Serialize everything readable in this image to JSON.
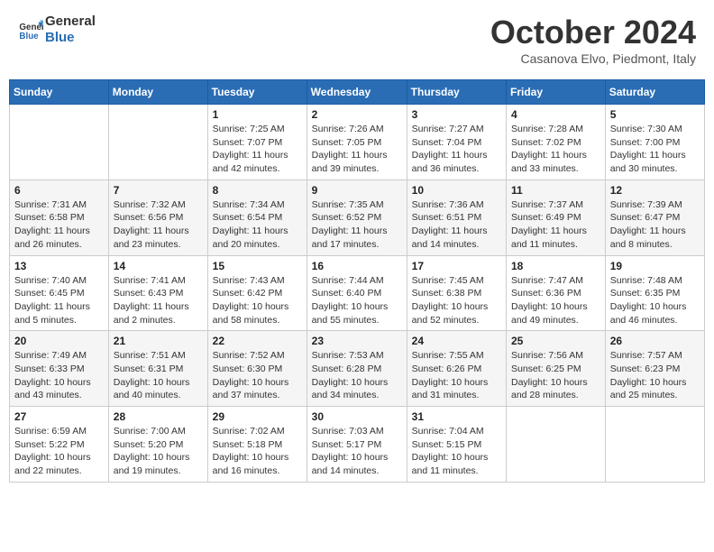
{
  "header": {
    "logo_line1": "General",
    "logo_line2": "Blue",
    "month": "October 2024",
    "location": "Casanova Elvo, Piedmont, Italy"
  },
  "weekdays": [
    "Sunday",
    "Monday",
    "Tuesday",
    "Wednesday",
    "Thursday",
    "Friday",
    "Saturday"
  ],
  "weeks": [
    [
      {
        "day": "",
        "info": ""
      },
      {
        "day": "",
        "info": ""
      },
      {
        "day": "1",
        "info": "Sunrise: 7:25 AM\nSunset: 7:07 PM\nDaylight: 11 hours and 42 minutes."
      },
      {
        "day": "2",
        "info": "Sunrise: 7:26 AM\nSunset: 7:05 PM\nDaylight: 11 hours and 39 minutes."
      },
      {
        "day": "3",
        "info": "Sunrise: 7:27 AM\nSunset: 7:04 PM\nDaylight: 11 hours and 36 minutes."
      },
      {
        "day": "4",
        "info": "Sunrise: 7:28 AM\nSunset: 7:02 PM\nDaylight: 11 hours and 33 minutes."
      },
      {
        "day": "5",
        "info": "Sunrise: 7:30 AM\nSunset: 7:00 PM\nDaylight: 11 hours and 30 minutes."
      }
    ],
    [
      {
        "day": "6",
        "info": "Sunrise: 7:31 AM\nSunset: 6:58 PM\nDaylight: 11 hours and 26 minutes."
      },
      {
        "day": "7",
        "info": "Sunrise: 7:32 AM\nSunset: 6:56 PM\nDaylight: 11 hours and 23 minutes."
      },
      {
        "day": "8",
        "info": "Sunrise: 7:34 AM\nSunset: 6:54 PM\nDaylight: 11 hours and 20 minutes."
      },
      {
        "day": "9",
        "info": "Sunrise: 7:35 AM\nSunset: 6:52 PM\nDaylight: 11 hours and 17 minutes."
      },
      {
        "day": "10",
        "info": "Sunrise: 7:36 AM\nSunset: 6:51 PM\nDaylight: 11 hours and 14 minutes."
      },
      {
        "day": "11",
        "info": "Sunrise: 7:37 AM\nSunset: 6:49 PM\nDaylight: 11 hours and 11 minutes."
      },
      {
        "day": "12",
        "info": "Sunrise: 7:39 AM\nSunset: 6:47 PM\nDaylight: 11 hours and 8 minutes."
      }
    ],
    [
      {
        "day": "13",
        "info": "Sunrise: 7:40 AM\nSunset: 6:45 PM\nDaylight: 11 hours and 5 minutes."
      },
      {
        "day": "14",
        "info": "Sunrise: 7:41 AM\nSunset: 6:43 PM\nDaylight: 11 hours and 2 minutes."
      },
      {
        "day": "15",
        "info": "Sunrise: 7:43 AM\nSunset: 6:42 PM\nDaylight: 10 hours and 58 minutes."
      },
      {
        "day": "16",
        "info": "Sunrise: 7:44 AM\nSunset: 6:40 PM\nDaylight: 10 hours and 55 minutes."
      },
      {
        "day": "17",
        "info": "Sunrise: 7:45 AM\nSunset: 6:38 PM\nDaylight: 10 hours and 52 minutes."
      },
      {
        "day": "18",
        "info": "Sunrise: 7:47 AM\nSunset: 6:36 PM\nDaylight: 10 hours and 49 minutes."
      },
      {
        "day": "19",
        "info": "Sunrise: 7:48 AM\nSunset: 6:35 PM\nDaylight: 10 hours and 46 minutes."
      }
    ],
    [
      {
        "day": "20",
        "info": "Sunrise: 7:49 AM\nSunset: 6:33 PM\nDaylight: 10 hours and 43 minutes."
      },
      {
        "day": "21",
        "info": "Sunrise: 7:51 AM\nSunset: 6:31 PM\nDaylight: 10 hours and 40 minutes."
      },
      {
        "day": "22",
        "info": "Sunrise: 7:52 AM\nSunset: 6:30 PM\nDaylight: 10 hours and 37 minutes."
      },
      {
        "day": "23",
        "info": "Sunrise: 7:53 AM\nSunset: 6:28 PM\nDaylight: 10 hours and 34 minutes."
      },
      {
        "day": "24",
        "info": "Sunrise: 7:55 AM\nSunset: 6:26 PM\nDaylight: 10 hours and 31 minutes."
      },
      {
        "day": "25",
        "info": "Sunrise: 7:56 AM\nSunset: 6:25 PM\nDaylight: 10 hours and 28 minutes."
      },
      {
        "day": "26",
        "info": "Sunrise: 7:57 AM\nSunset: 6:23 PM\nDaylight: 10 hours and 25 minutes."
      }
    ],
    [
      {
        "day": "27",
        "info": "Sunrise: 6:59 AM\nSunset: 5:22 PM\nDaylight: 10 hours and 22 minutes."
      },
      {
        "day": "28",
        "info": "Sunrise: 7:00 AM\nSunset: 5:20 PM\nDaylight: 10 hours and 19 minutes."
      },
      {
        "day": "29",
        "info": "Sunrise: 7:02 AM\nSunset: 5:18 PM\nDaylight: 10 hours and 16 minutes."
      },
      {
        "day": "30",
        "info": "Sunrise: 7:03 AM\nSunset: 5:17 PM\nDaylight: 10 hours and 14 minutes."
      },
      {
        "day": "31",
        "info": "Sunrise: 7:04 AM\nSunset: 5:15 PM\nDaylight: 10 hours and 11 minutes."
      },
      {
        "day": "",
        "info": ""
      },
      {
        "day": "",
        "info": ""
      }
    ]
  ]
}
